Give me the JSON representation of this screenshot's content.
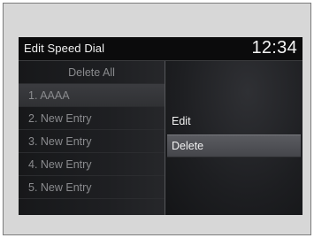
{
  "header": {
    "title": "Edit Speed Dial",
    "clock": "12:34"
  },
  "list": {
    "items": [
      {
        "label": "Delete All"
      },
      {
        "label": "1. AAAA"
      },
      {
        "label": "2. New Entry"
      },
      {
        "label": "3. New Entry"
      },
      {
        "label": "4. New Entry"
      },
      {
        "label": "5. New Entry"
      }
    ],
    "selected_index": 1
  },
  "context_menu": {
    "items": [
      {
        "label": "Edit"
      },
      {
        "label": "Delete"
      }
    ],
    "highlighted_index": 1
  },
  "colors": {
    "screen_background": "#111214",
    "frame_background": "#d7d7d7",
    "inactive_text": "#8a8b8e",
    "active_text": "#f2f2f2",
    "highlight": "#4f5055"
  }
}
